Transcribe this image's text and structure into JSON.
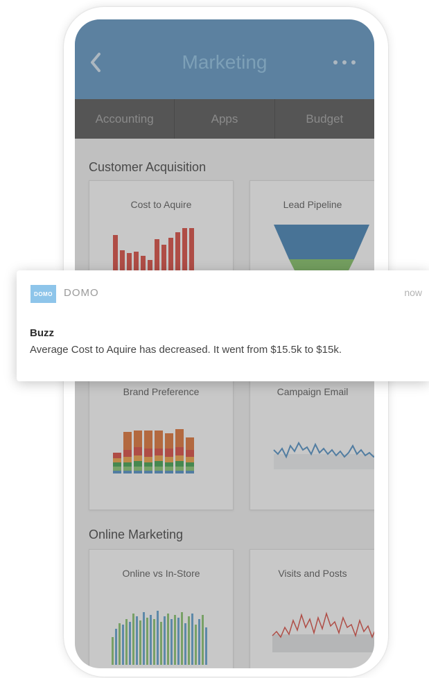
{
  "header": {
    "title": "Marketing"
  },
  "tabs": [
    {
      "label": "Accounting"
    },
    {
      "label": "Apps"
    },
    {
      "label": "Budget"
    }
  ],
  "sections": [
    {
      "title": "Customer Acquisition",
      "cards": [
        {
          "title": "Cost to Aquire",
          "chart": "bar"
        },
        {
          "title": "Lead Pipeline",
          "chart": "funnel"
        },
        {
          "title": "Brand Preference",
          "chart": "stacked-bar"
        },
        {
          "title": "Campaign Email",
          "chart": "line"
        }
      ]
    },
    {
      "title": "Online Marketing",
      "cards": [
        {
          "title": "Online vs In-Store",
          "chart": "bar"
        },
        {
          "title": "Visits and Posts",
          "chart": "line"
        }
      ]
    }
  ],
  "notification": {
    "app_name": "DOMO",
    "logo_text": "DOMO",
    "time": "now",
    "title": "Buzz",
    "body": "Average Cost to Aquire has decreased. It went from $15.5k to $15k."
  },
  "colors": {
    "header": "#5c93c3",
    "tabbar": "#515151",
    "bar_red": "#d9453a",
    "funnel_blue": "#3d7fb3",
    "funnel_green": "#7fc060",
    "line_blue": "#4d8ec4",
    "line_red": "#d9453a",
    "bar_green": "#86c46b"
  }
}
